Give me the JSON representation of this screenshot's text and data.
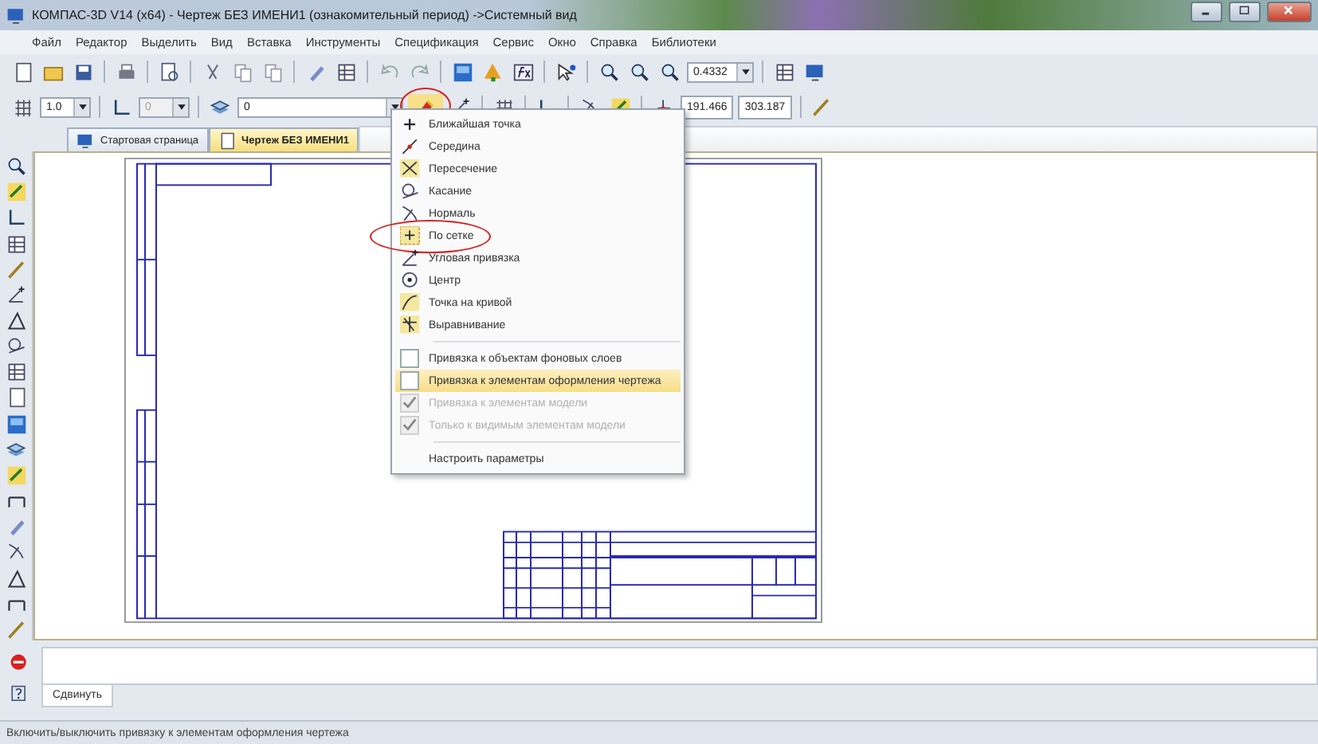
{
  "window": {
    "title": "КОМПАС-3D V14 (x64) - Чертеж БЕЗ ИМЕНИ1 (ознакомительный период) ->Системный вид"
  },
  "menu": [
    "Файл",
    "Редактор",
    "Выделить",
    "Вид",
    "Вставка",
    "Инструменты",
    "Спецификация",
    "Сервис",
    "Окно",
    "Справка",
    "Библиотеки"
  ],
  "toolbar": {
    "zoom_value": "0.4332"
  },
  "properties_bar": {
    "fields": [
      {
        "value": "1.0",
        "disabled": false
      },
      {
        "value": "0",
        "disabled": true
      },
      {
        "value": "0",
        "disabled": false
      }
    ],
    "snap_button": {
      "circled": true,
      "expanded": true
    },
    "x_value": "191.466",
    "y_value": "303.187"
  },
  "tabs": [
    {
      "label": "Стартовая страница",
      "selected": false
    },
    {
      "label": "Чертеж БЕЗ ИМЕНИ1",
      "selected": true
    }
  ],
  "snap_menu": {
    "items": [
      {
        "kind": "snap",
        "label": "Ближайшая точка",
        "circled": false
      },
      {
        "kind": "snap",
        "label": "Середина",
        "circled": false
      },
      {
        "kind": "snap",
        "label": "Пересечение",
        "circled": false
      },
      {
        "kind": "snap",
        "label": "Касание",
        "circled": false
      },
      {
        "kind": "snap",
        "label": "Нормаль",
        "circled": false
      },
      {
        "kind": "snap",
        "label": "По сетке",
        "circled": true
      },
      {
        "kind": "snap",
        "label": "Угловая привязка",
        "circled": false
      },
      {
        "kind": "snap",
        "label": "Центр",
        "circled": false
      },
      {
        "kind": "snap",
        "label": "Точка на кривой",
        "circled": false
      },
      {
        "kind": "snap",
        "label": "Выравнивание",
        "circled": false
      },
      {
        "kind": "separator"
      },
      {
        "kind": "option",
        "label": "Привязка к объектам фоновых слоев",
        "selected": false,
        "checked": false,
        "disabled": false
      },
      {
        "kind": "option",
        "label": "Привязка к элементам оформления чертежа",
        "selected": true,
        "checked": false,
        "disabled": false
      },
      {
        "kind": "option",
        "label": "Привязка к элементам модели",
        "selected": false,
        "checked": true,
        "disabled": true
      },
      {
        "kind": "option",
        "label": "Только к видимым элементам модели",
        "selected": false,
        "checked": true,
        "disabled": true
      },
      {
        "kind": "separator"
      },
      {
        "kind": "command",
        "label": "Настроить параметры"
      }
    ]
  },
  "command_panel": {
    "tab": "Сдвинуть"
  },
  "status_bar": {
    "text": "Включить/выключить привязку к элементам оформления чертежа"
  }
}
